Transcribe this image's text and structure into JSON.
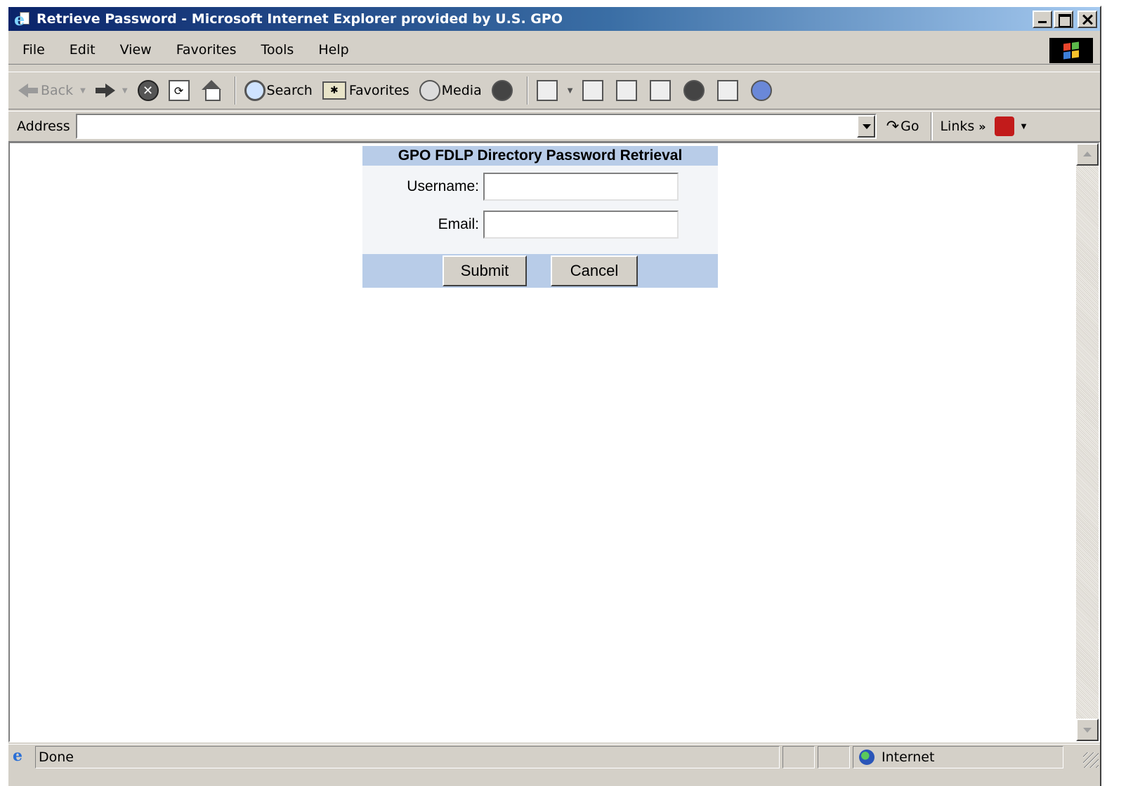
{
  "window": {
    "title": "Retrieve Password - Microsoft Internet Explorer provided by U.S. GPO"
  },
  "menu": [
    "File",
    "Edit",
    "View",
    "Favorites",
    "Tools",
    "Help"
  ],
  "toolbar": {
    "back_label": "Back",
    "search_label": "Search",
    "favorites_label": "Favorites",
    "media_label": "Media"
  },
  "address": {
    "label": "Address",
    "value": "",
    "go_label": "Go",
    "links_label": "Links"
  },
  "form": {
    "heading": "GPO FDLP Directory Password Retrieval",
    "username_label": "Username:",
    "username_value": "",
    "email_label": "Email:",
    "email_value": "",
    "submit_label": "Submit",
    "cancel_label": "Cancel"
  },
  "status": {
    "text": "Done",
    "zone": "Internet"
  },
  "colors": {
    "form_header_bg": "#b8cce8",
    "form_body_bg": "#f3f5f8",
    "titlebar_start": "#0a246a",
    "titlebar_end": "#a6caf0"
  }
}
